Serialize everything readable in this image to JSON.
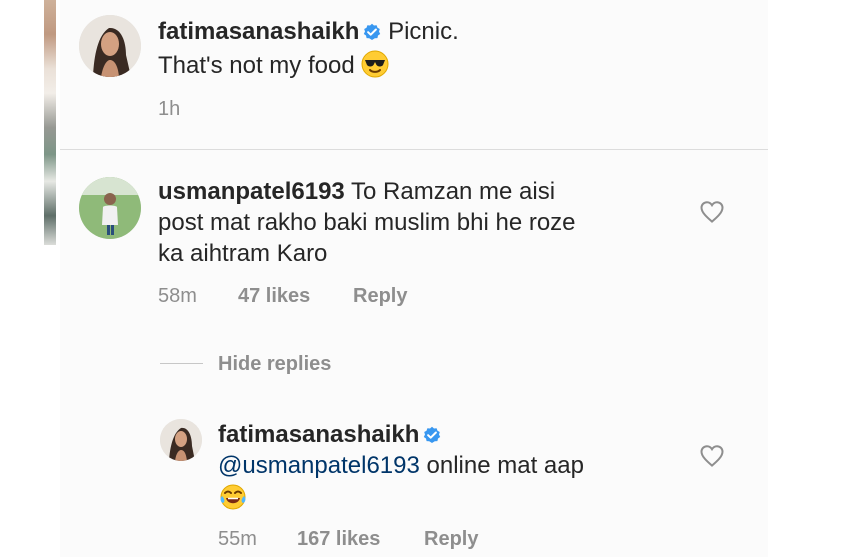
{
  "post": {
    "username": "fatimasanashaikh",
    "caption_line1": "Picnic.",
    "caption_line2": "That's not my food",
    "caption_emoji": "smiling-face-with-sunglasses-icon",
    "time": "1h"
  },
  "comment": {
    "username": "usmanpatel6193",
    "text_line1": "To Ramzan me aisi",
    "text_line2": "post mat rakho baki muslim bhi he roze",
    "text_line3": "ka aihtram Karo",
    "time": "58m",
    "likes": "47 likes",
    "reply_label": "Reply",
    "hide_replies_label": "Hide replies"
  },
  "reply": {
    "username": "fatimasanashaikh",
    "mention": "@usmanpatel6193",
    "text": "online mat aap",
    "emoji": "face-with-tears-of-joy-icon",
    "time": "55m",
    "likes": "167 likes",
    "reply_label": "Reply"
  },
  "colors": {
    "text": "#262626",
    "muted": "#8e8e8e",
    "verified": "#3897f0",
    "mention": "#003569"
  }
}
